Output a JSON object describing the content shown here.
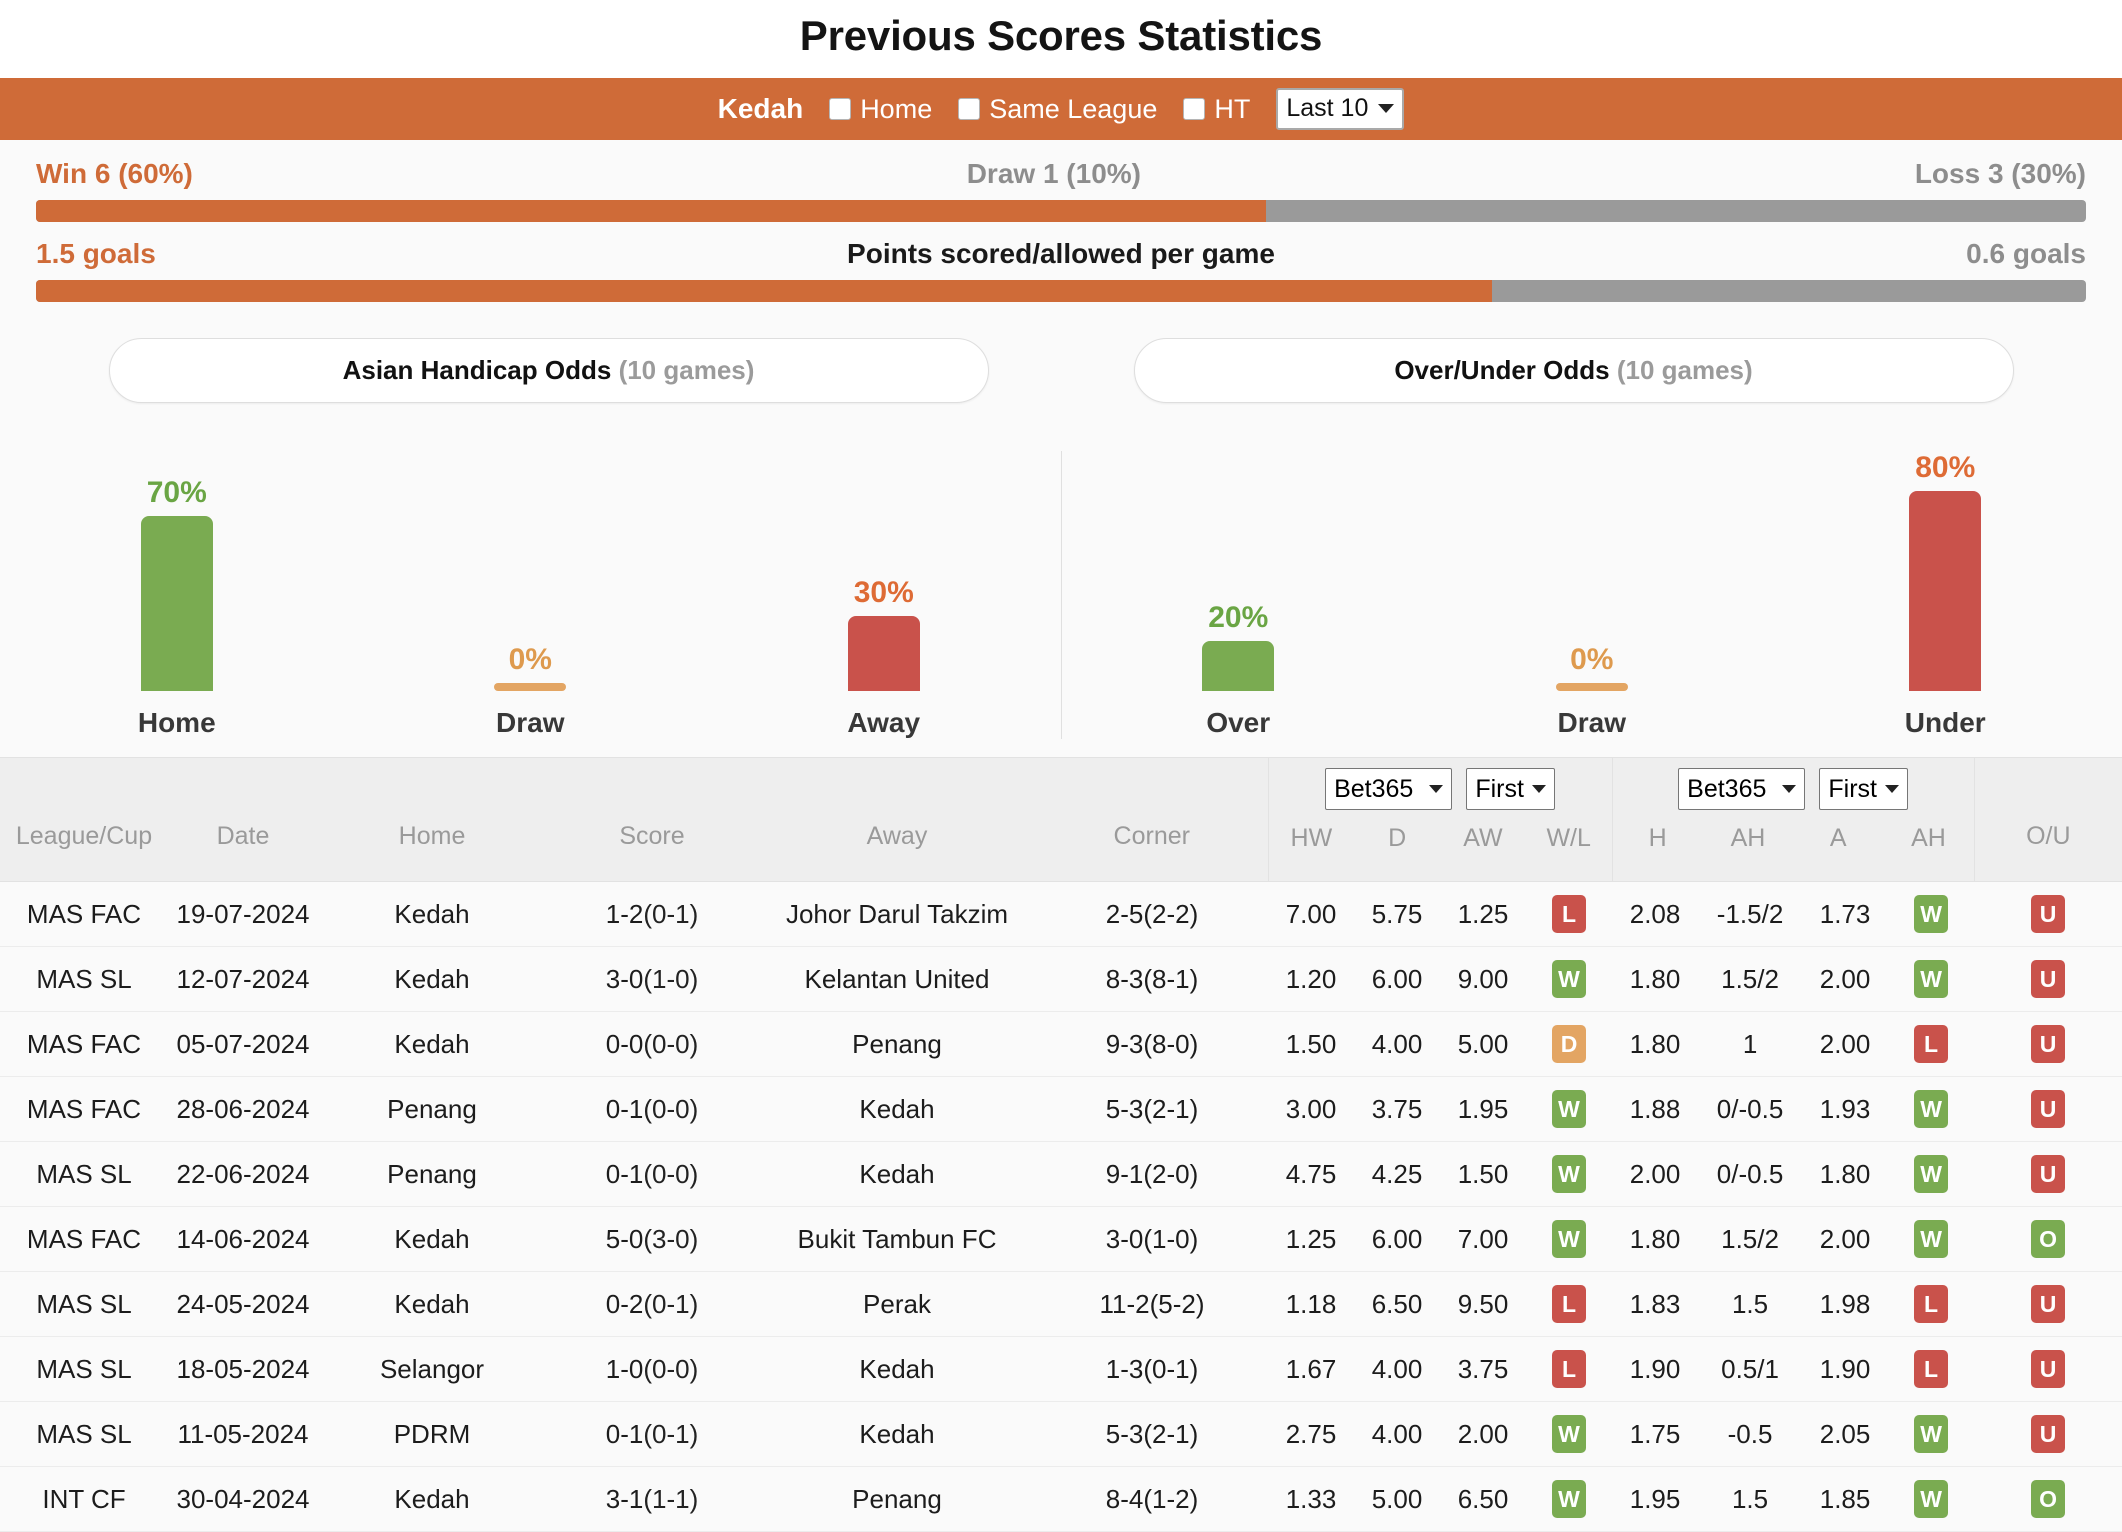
{
  "header": {
    "title": "Previous Scores Statistics"
  },
  "filter": {
    "team": "Kedah",
    "options": [
      {
        "label": "Home",
        "checked": false
      },
      {
        "label": "Same League",
        "checked": false
      },
      {
        "label": "HT",
        "checked": false
      }
    ],
    "range_select": "Last 10"
  },
  "summary": {
    "record": {
      "win": "Win 6 (60%)",
      "draw": "Draw 1 (10%)",
      "loss": "Loss 3 (30%)",
      "win_pct": 60,
      "rest_pct": 40
    },
    "points": {
      "scored": "1.5 goals",
      "title": "Points scored/allowed per game",
      "allowed": "0.6 goals",
      "scored_pct": 71,
      "allowed_pct": 29
    }
  },
  "odds": {
    "tabs": [
      {
        "label": "Asian Handicap Odds",
        "sub": "(10 games)"
      },
      {
        "label": "Over/Under Odds",
        "sub": "(10 games)"
      }
    ]
  },
  "chart_data": [
    {
      "type": "bar",
      "title": "Asian Handicap Odds (10 games)",
      "categories": [
        "Home",
        "Draw",
        "Away"
      ],
      "values": [
        70,
        0,
        30
      ],
      "labels": [
        "70%",
        "0%",
        "30%"
      ],
      "colors": [
        "#7aab51",
        "#e3a563",
        "#c9524b"
      ],
      "label_colors": [
        "#6aa544",
        "#de9a4e",
        "#de6b35"
      ],
      "ylabel": "",
      "xlabel": "",
      "ylim": [
        0,
        100
      ]
    },
    {
      "type": "bar",
      "title": "Over/Under Odds (10 games)",
      "categories": [
        "Over",
        "Draw",
        "Under"
      ],
      "values": [
        20,
        0,
        80
      ],
      "labels": [
        "20%",
        "0%",
        "80%"
      ],
      "colors": [
        "#7aab51",
        "#e3a563",
        "#c9524b"
      ],
      "label_colors": [
        "#6aa544",
        "#de9a4e",
        "#de6b35"
      ],
      "ylabel": "",
      "xlabel": "",
      "ylim": [
        0,
        100
      ]
    }
  ],
  "table": {
    "headers": {
      "league": "League/Cup",
      "date": "Date",
      "home": "Home",
      "score": "Score",
      "away": "Away",
      "corner": "Corner",
      "ou": "O/U"
    },
    "group1": {
      "bookmaker": "Bet365",
      "period": "First",
      "cols": [
        "HW",
        "D",
        "AW",
        "W/L"
      ]
    },
    "group2": {
      "bookmaker": "Bet365",
      "period": "First",
      "cols": [
        "H",
        "AH",
        "A",
        "AH"
      ]
    },
    "rows": [
      {
        "league": "MAS FAC",
        "date": "19-07-2024",
        "home": "Kedah",
        "home_hl": true,
        "score": "1-2",
        "ht": "(0-1)",
        "away": "Johor Darul Takzim",
        "away_hl": false,
        "corner": "2-5(2-2)",
        "hw": "7.00",
        "d": "5.75",
        "aw": "1.25",
        "wl": "L",
        "h": "2.08",
        "ah1": "-1.5/2",
        "a": "1.73",
        "ah2": "W",
        "ou": "U"
      },
      {
        "league": "MAS SL",
        "date": "12-07-2024",
        "home": "Kedah",
        "home_hl": true,
        "score": "3-0",
        "ht": "(1-0)",
        "away": "Kelantan United",
        "away_hl": false,
        "corner": "8-3(8-1)",
        "hw": "1.20",
        "d": "6.00",
        "aw": "9.00",
        "wl": "W",
        "h": "1.80",
        "ah1": "1.5/2",
        "a": "2.00",
        "ah2": "W",
        "ou": "U"
      },
      {
        "league": "MAS FAC",
        "date": "05-07-2024",
        "home": "Kedah",
        "home_hl": true,
        "score": "0-0",
        "ht": "(0-0)",
        "away": "Penang",
        "away_hl": false,
        "corner": "9-3(8-0)",
        "hw": "1.50",
        "d": "4.00",
        "aw": "5.00",
        "wl": "D",
        "h": "1.80",
        "ah1": "1",
        "a": "2.00",
        "ah2": "L",
        "ou": "U"
      },
      {
        "league": "MAS FAC",
        "date": "28-06-2024",
        "home": "Penang",
        "home_hl": false,
        "score": "0-1",
        "ht": "(0-0)",
        "away": "Kedah",
        "away_hl": true,
        "corner": "5-3(2-1)",
        "hw": "3.00",
        "d": "3.75",
        "aw": "1.95",
        "wl": "W",
        "h": "1.88",
        "ah1": "0/-0.5",
        "a": "1.93",
        "ah2": "W",
        "ou": "U"
      },
      {
        "league": "MAS SL",
        "date": "22-06-2024",
        "home": "Penang",
        "home_hl": false,
        "score": "0-1",
        "ht": "(0-0)",
        "away": "Kedah",
        "away_hl": true,
        "corner": "9-1(2-0)",
        "hw": "4.75",
        "d": "4.25",
        "aw": "1.50",
        "wl": "W",
        "h": "2.00",
        "ah1": "0/-0.5",
        "a": "1.80",
        "ah2": "W",
        "ou": "U"
      },
      {
        "league": "MAS FAC",
        "date": "14-06-2024",
        "home": "Kedah",
        "home_hl": true,
        "score": "5-0",
        "ht": "(3-0)",
        "away": "Bukit Tambun FC",
        "away_hl": false,
        "corner": "3-0(1-0)",
        "hw": "1.25",
        "d": "6.00",
        "aw": "7.00",
        "wl": "W",
        "h": "1.80",
        "ah1": "1.5/2",
        "a": "2.00",
        "ah2": "W",
        "ou": "O"
      },
      {
        "league": "MAS SL",
        "date": "24-05-2024",
        "home": "Kedah",
        "home_hl": true,
        "score": "0-2",
        "ht": "(0-1)",
        "away": "Perak",
        "away_hl": false,
        "corner": "11-2(5-2)",
        "hw": "1.18",
        "d": "6.50",
        "aw": "9.50",
        "wl": "L",
        "h": "1.83",
        "ah1": "1.5",
        "a": "1.98",
        "ah2": "L",
        "ou": "U"
      },
      {
        "league": "MAS SL",
        "date": "18-05-2024",
        "home": "Selangor",
        "home_hl": false,
        "score": "1-0",
        "ht": "(0-0)",
        "away": "Kedah",
        "away_hl": true,
        "corner": "1-3(0-1)",
        "hw": "1.67",
        "d": "4.00",
        "aw": "3.75",
        "wl": "L",
        "h": "1.90",
        "ah1": "0.5/1",
        "a": "1.90",
        "ah2": "L",
        "ou": "U"
      },
      {
        "league": "MAS SL",
        "date": "11-05-2024",
        "home": "PDRM",
        "home_hl": false,
        "score": "0-1",
        "ht": "(0-1)",
        "away": "Kedah",
        "away_hl": true,
        "corner": "5-3(2-1)",
        "hw": "2.75",
        "d": "4.00",
        "aw": "2.00",
        "wl": "W",
        "h": "1.75",
        "ah1": "-0.5",
        "a": "2.05",
        "ah2": "W",
        "ou": "U"
      },
      {
        "league": "INT CF",
        "date": "30-04-2024",
        "home": "Kedah",
        "home_hl": true,
        "score": "3-1",
        "ht": "(1-1)",
        "away": "Penang",
        "away_hl": false,
        "corner": "8-4(1-2)",
        "hw": "1.33",
        "d": "5.00",
        "aw": "6.50",
        "wl": "W",
        "h": "1.95",
        "ah1": "1.5",
        "a": "1.85",
        "ah2": "W",
        "ou": "O"
      }
    ]
  },
  "colors": {
    "accent": "#cf6b38",
    "win": "#7aab51",
    "loss": "#c9524b",
    "draw": "#e3a563",
    "muted": "#9a9a9a"
  }
}
